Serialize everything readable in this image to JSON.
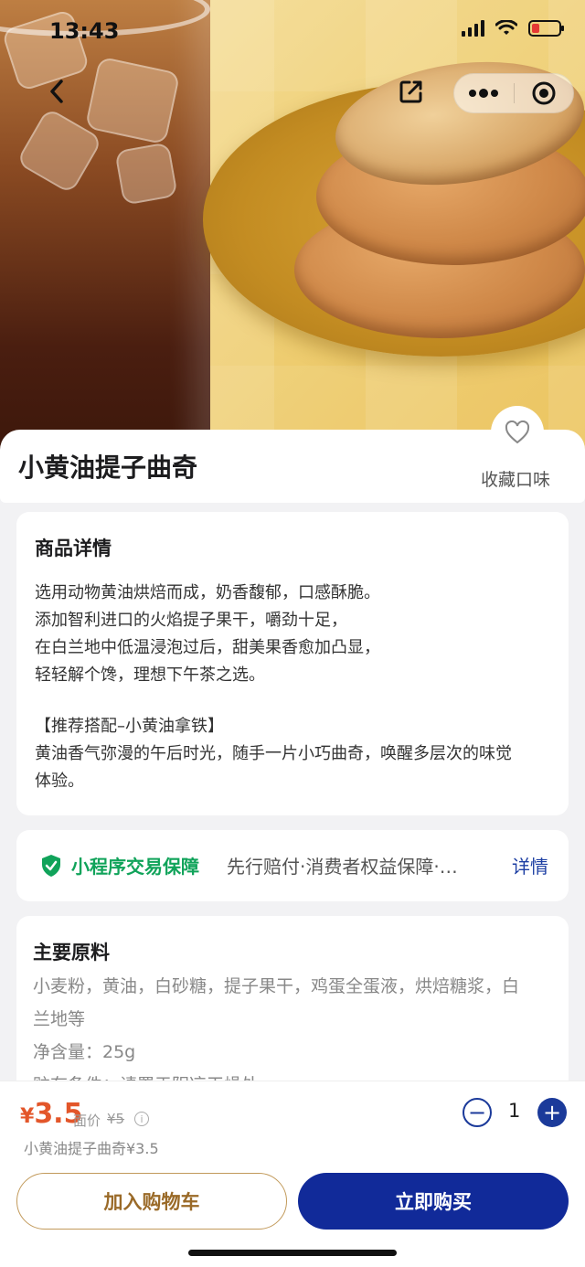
{
  "status_bar": {
    "time": "13:43"
  },
  "product": {
    "title": "小黄油提子曲奇",
    "favorite_label": "收藏口味"
  },
  "details": {
    "heading": "商品详情",
    "lines": [
      "选用动物黄油烘焙而成，奶香馥郁，口感酥脆。",
      "添加智利进口的火焰提子果干，嚼劲十足，",
      "在白兰地中低温浸泡过后，甜美果香愈加凸显，",
      "轻轻解个馋，理想下午茶之选。",
      "【推荐搭配–小黄油拿铁】",
      "黄油香气弥漫的午后时光，随手一片小巧曲奇，唤醒多层次的味觉",
      "体验。"
    ]
  },
  "guarantee": {
    "title": "小程序交易保障",
    "text": "先行赔付·消费者权益保障·…",
    "link": "详情"
  },
  "ingredients": {
    "heading": "主要原料",
    "lines": [
      "小麦粉，黄油，白砂糖，提子果干，鸡蛋全蛋液，烘焙糖浆，白",
      "兰地等",
      "净含量：25g",
      "贮存条件：请置于阴凉干燥处"
    ]
  },
  "purchase": {
    "currency": "¥",
    "price": "3.5",
    "orig_label": "面价",
    "orig_price": "¥5",
    "summary": "小黄油提子曲奇¥3.5",
    "quantity": "1",
    "minus": "−",
    "plus": "+",
    "add_to_cart": "加入购物车",
    "buy_now": "立即购买"
  },
  "colors": {
    "accent_blue": "#112a99",
    "price_orange": "#e3562a",
    "guarantee_green": "#10a35a",
    "cart_gold": "#9a6a28"
  },
  "icons": [
    "back-chevron-icon",
    "share-icon",
    "more-dots-icon",
    "target-icon",
    "heart-icon",
    "shield-check-icon",
    "info-icon"
  ]
}
